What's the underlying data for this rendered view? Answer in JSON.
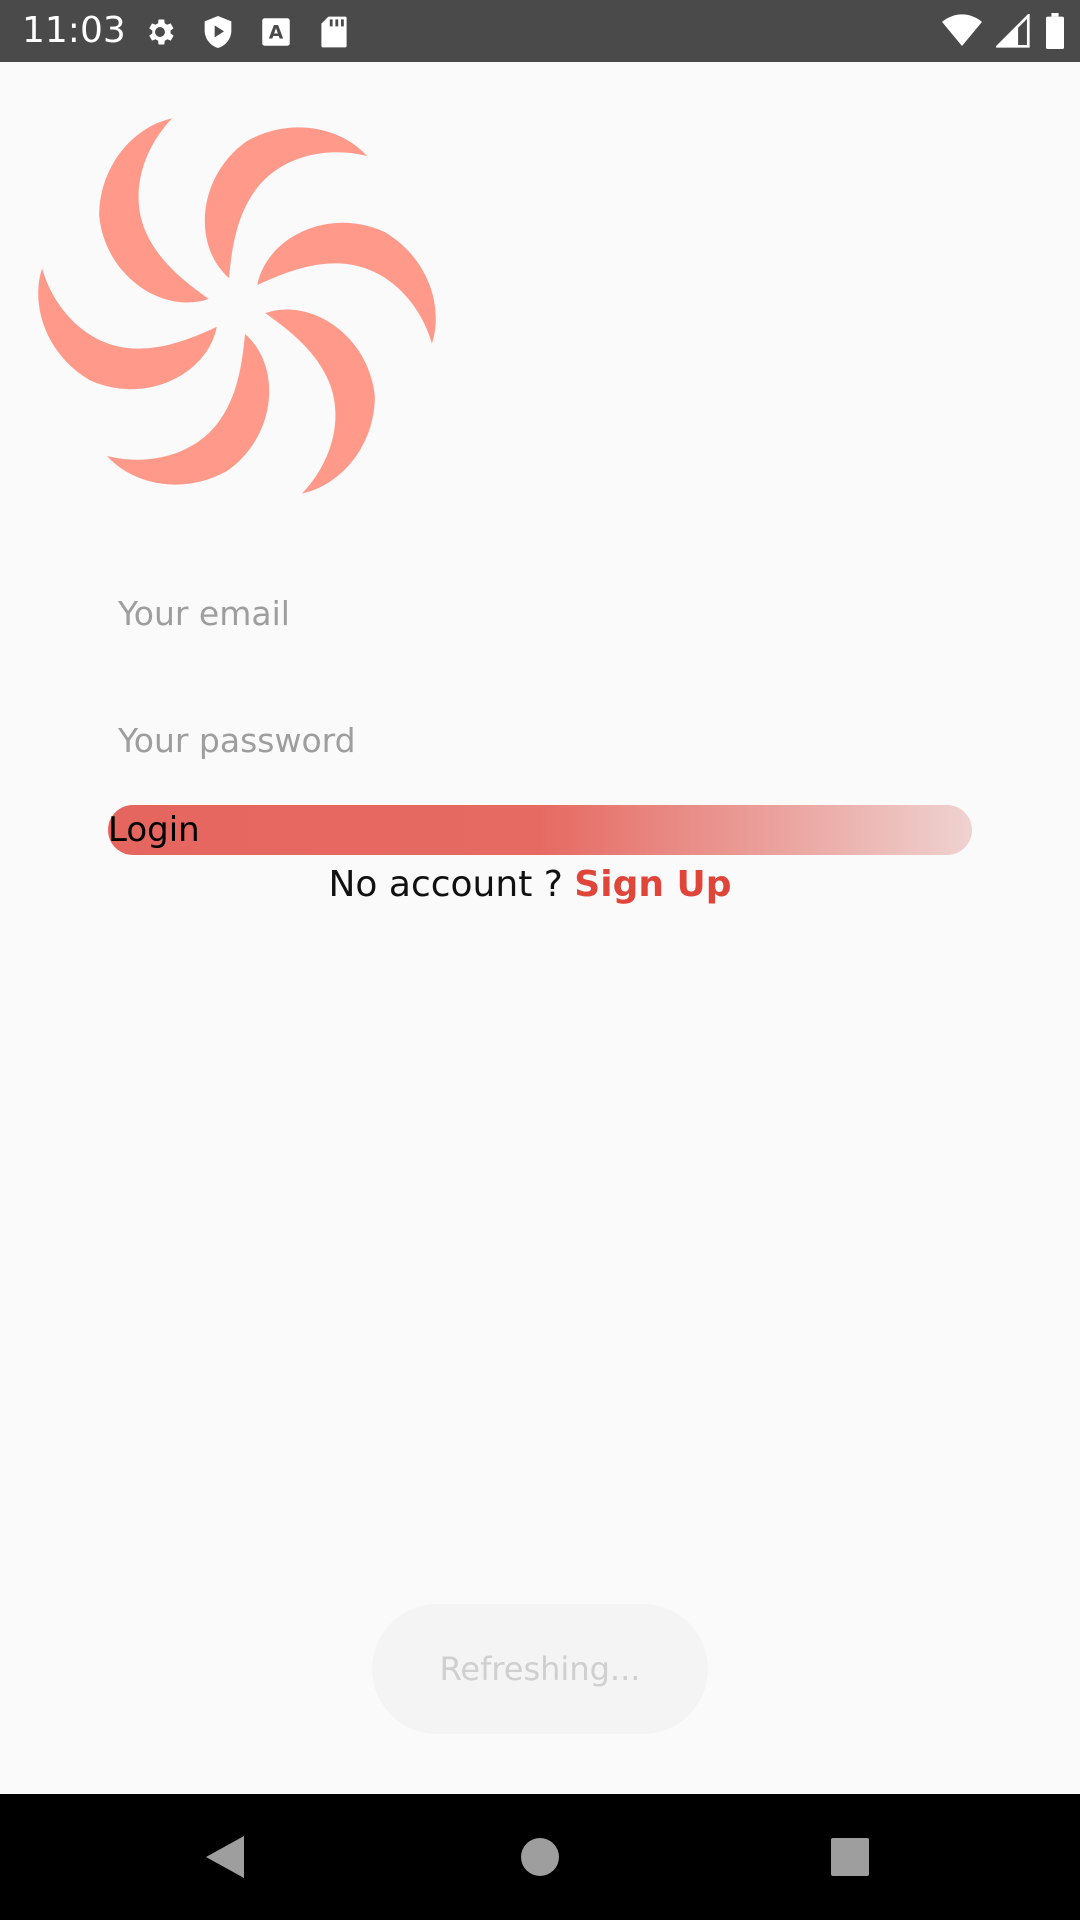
{
  "status_bar": {
    "time": "11:03",
    "left_icons": [
      "gear-icon",
      "shield-play-icon",
      "a-box-icon",
      "sd-card-icon"
    ],
    "right_icons": [
      "wifi-icon",
      "signal-icon",
      "battery-icon"
    ],
    "background": "#4a4a4a"
  },
  "logo": {
    "icon": "pinwheel-logo-icon",
    "color": "#ff9a8b"
  },
  "form": {
    "email_placeholder": "Your email",
    "email_value": "",
    "password_placeholder": "Your password",
    "password_value": "",
    "login_label": "Login"
  },
  "signup": {
    "prompt": "No account ? ",
    "link_label": "Sign Up",
    "link_color": "#e0453a"
  },
  "toast": {
    "text": "Refreshing..."
  },
  "nav_bar": {
    "icons": [
      "back-icon",
      "home-icon",
      "recents-icon"
    ]
  }
}
